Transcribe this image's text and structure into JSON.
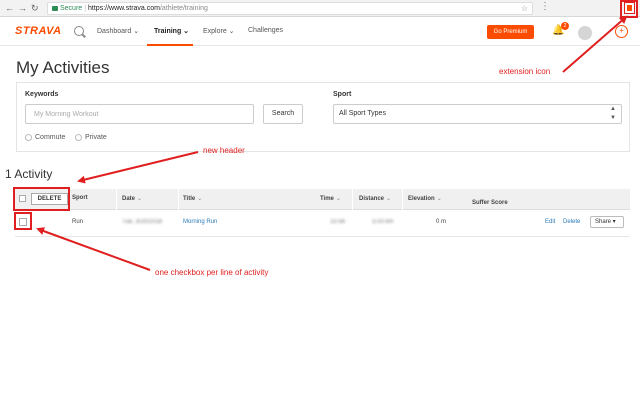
{
  "browser": {
    "secure_label": "Secure",
    "url_host": "https://www.strava.com",
    "url_path": "/athlete/training"
  },
  "header": {
    "logo": "STRAVA",
    "nav": [
      "Dashboard",
      "Training",
      "Explore",
      "Challenges"
    ],
    "premium_button": "Go Premium",
    "notification_count": "2"
  },
  "page": {
    "title": "My Activities"
  },
  "filters": {
    "keywords_label": "Keywords",
    "keywords_placeholder": "My Morning Workout",
    "search_button": "Search",
    "sport_label": "Sport",
    "sport_value": "All Sport Types",
    "commute_label": "Commute",
    "private_label": "Private"
  },
  "activities": {
    "count_title": "1 Activity",
    "delete_button": "DELETE",
    "columns": [
      "Sport",
      "Date",
      "Title",
      "Time",
      "Distance",
      "Elevation",
      "Suffer Score"
    ],
    "rows": [
      {
        "sport": "Run",
        "date": "Tue, 3/20/2018",
        "title": "Morning Run",
        "time": "15:56",
        "distance": "3.03 km",
        "elevation": "0 m",
        "edit": "Edit",
        "delete": "Delete",
        "share": "Share"
      }
    ]
  },
  "annotations": {
    "extension_icon": "extension icon",
    "new_header": "new header",
    "checkbox_note": "one checkbox per line of activity"
  },
  "colors": {
    "brand": "#fc4c02",
    "annotation": "#e02020",
    "link": "#2b7bb9"
  }
}
